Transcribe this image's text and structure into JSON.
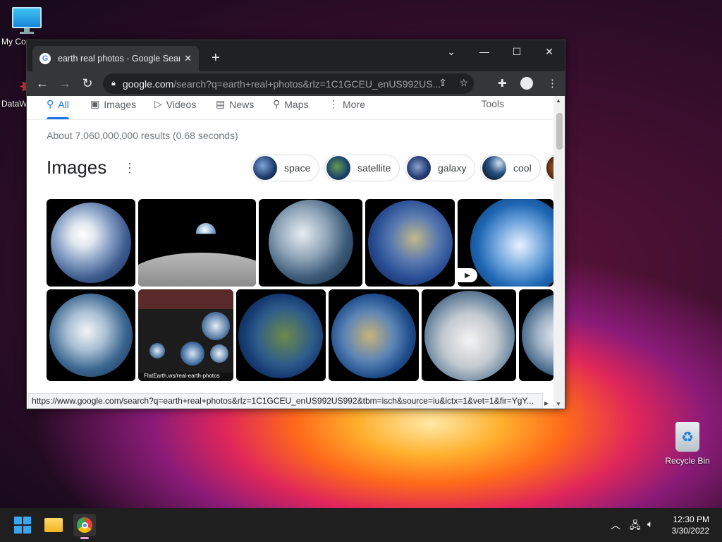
{
  "desktop": {
    "icons": [
      {
        "label": "My Co",
        "name": "my-computer"
      },
      {
        "label": "DataW",
        "name": "dataw"
      },
      {
        "label": "Recycle Bin",
        "name": "recycle-bin"
      }
    ]
  },
  "browser": {
    "tab_title": "earth real photos - Google Search",
    "url_host": "google.com",
    "url_path": "/search?q=earth+real+photos&rlz=1C1GCEU_enUS992US...",
    "status_url": "https://www.google.com/search?q=earth+real+photos&rlz=1C1GCEU_enUS992US992&tbm=isch&source=iu&ictx=1&vet=1&fir=YgY..."
  },
  "search": {
    "tabs": [
      {
        "label": "All",
        "icon": "search-icon",
        "active": true
      },
      {
        "label": "Images",
        "icon": "image-icon"
      },
      {
        "label": "Videos",
        "icon": "play-icon"
      },
      {
        "label": "News",
        "icon": "news-icon"
      },
      {
        "label": "Maps",
        "icon": "pin-icon"
      },
      {
        "label": "More",
        "icon": "more-vert-icon"
      }
    ],
    "tools_label": "Tools",
    "result_stats": "About 7,060,000,000 results (0.68 seconds)",
    "images_heading": "Images",
    "chips": [
      "space",
      "satellite",
      "galaxy",
      "cool"
    ],
    "infographic_caption": "FlatEarth.ws/real-earth-photos"
  },
  "taskbar": {
    "time": "12:30 PM",
    "date": "3/30/2022"
  }
}
